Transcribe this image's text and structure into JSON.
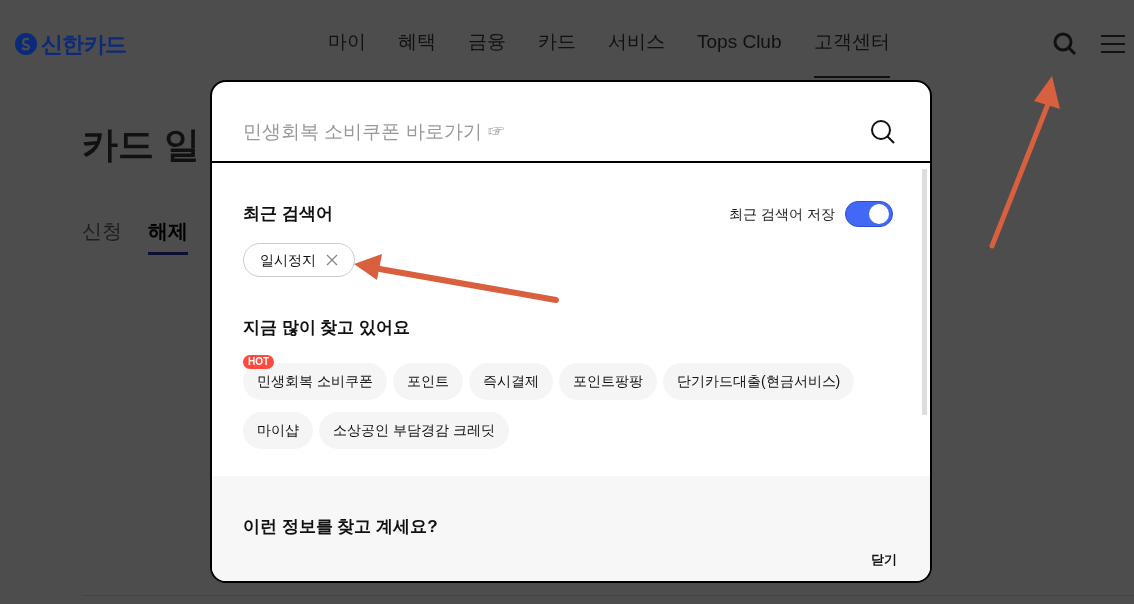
{
  "header": {
    "logo": "신한카드",
    "nav": [
      {
        "label": "마이",
        "selected": false
      },
      {
        "label": "혜택",
        "selected": false
      },
      {
        "label": "금융",
        "selected": false
      },
      {
        "label": "카드",
        "selected": false
      },
      {
        "label": "서비스",
        "selected": false
      },
      {
        "label": "Tops Club",
        "selected": false
      },
      {
        "label": "고객센터",
        "selected": true
      }
    ]
  },
  "page": {
    "title": "카드 일",
    "tabs": [
      {
        "label": "신청",
        "selected": false
      },
      {
        "label": "해제",
        "selected": true
      }
    ]
  },
  "search_modal": {
    "placeholder": "민생회복 소비쿠폰 바로가기 ☞",
    "recent": {
      "title": "최근 검색어",
      "save_label": "최근 검색어 저장",
      "save_on": true,
      "items": [
        "일시정지"
      ]
    },
    "popular": {
      "title": "지금 많이 찾고 있어요",
      "items": [
        {
          "label": "민생회복 소비쿠폰",
          "badge": "HOT"
        },
        {
          "label": "포인트"
        },
        {
          "label": "즉시결제"
        },
        {
          "label": "포인트팡팡"
        },
        {
          "label": "단기카드대출(현금서비스)"
        },
        {
          "label": "마이샵"
        },
        {
          "label": "소상공인 부담경감 크레딧"
        }
      ]
    },
    "suggest": {
      "title": "이런 정보를 찾고 계세요?"
    },
    "close": "닫기"
  }
}
